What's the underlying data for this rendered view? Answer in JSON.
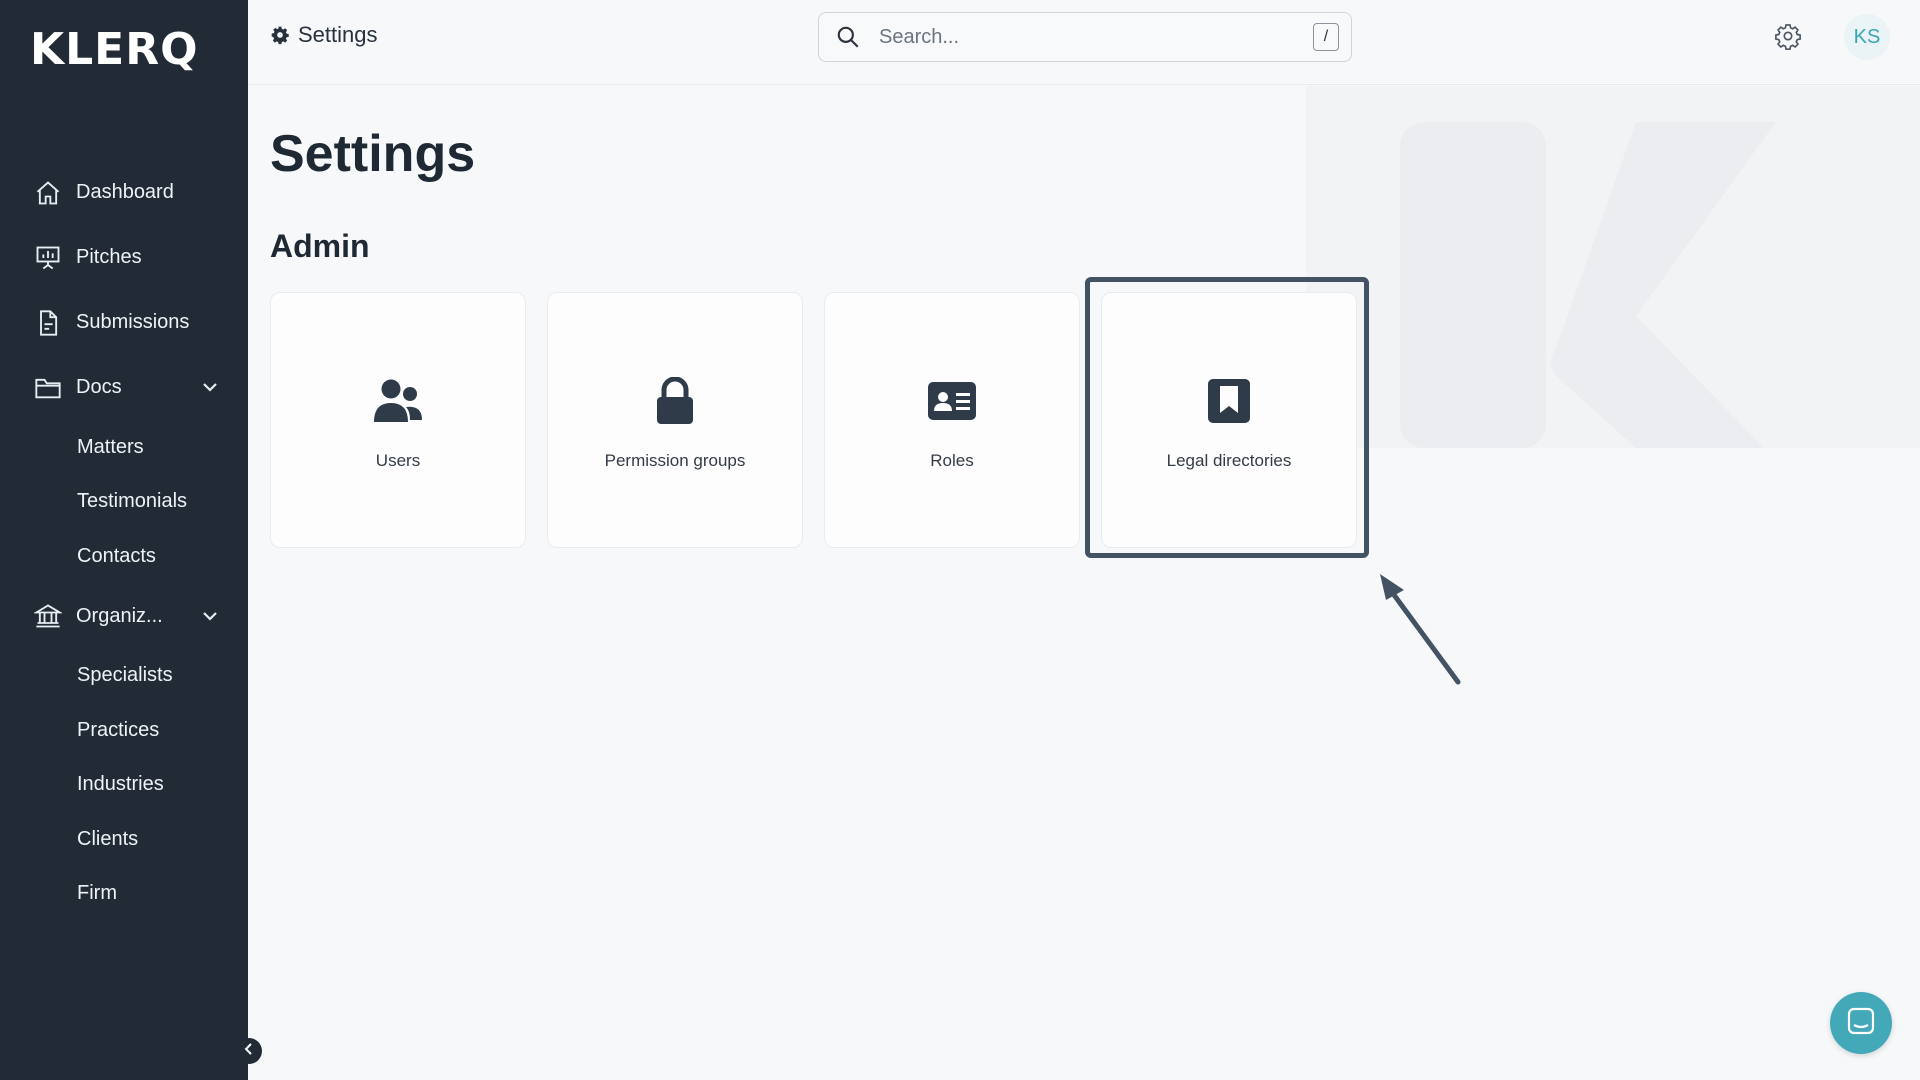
{
  "app": {
    "logo": "KLERQ"
  },
  "sidebar": {
    "items": [
      {
        "label": "Dashboard",
        "icon": "home-icon"
      },
      {
        "label": "Pitches",
        "icon": "presentation-icon"
      },
      {
        "label": "Submissions",
        "icon": "document-icon"
      },
      {
        "label": "Docs",
        "icon": "folder-icon",
        "expanded": true,
        "children": [
          "Matters",
          "Testimonials",
          "Contacts"
        ]
      },
      {
        "label": "Organiz...",
        "icon": "bank-icon",
        "expanded": true,
        "children": [
          "Specialists",
          "Practices",
          "Industries",
          "Clients",
          "Firm"
        ]
      }
    ]
  },
  "header": {
    "breadcrumb": "Settings",
    "search_placeholder": "Search...",
    "search_shortcut": "/",
    "avatar_initials": "KS"
  },
  "main": {
    "title": "Settings",
    "section": "Admin",
    "cards": [
      {
        "label": "Users",
        "icon": "users-icon"
      },
      {
        "label": "Permission groups",
        "icon": "lock-icon"
      },
      {
        "label": "Roles",
        "icon": "id-card-icon"
      },
      {
        "label": "Legal directories",
        "icon": "bookmark-icon",
        "highlighted": true
      }
    ]
  },
  "colors": {
    "sidebar_bg": "#222b35",
    "accent": "#43a8b8",
    "highlight_border": "#435363"
  }
}
